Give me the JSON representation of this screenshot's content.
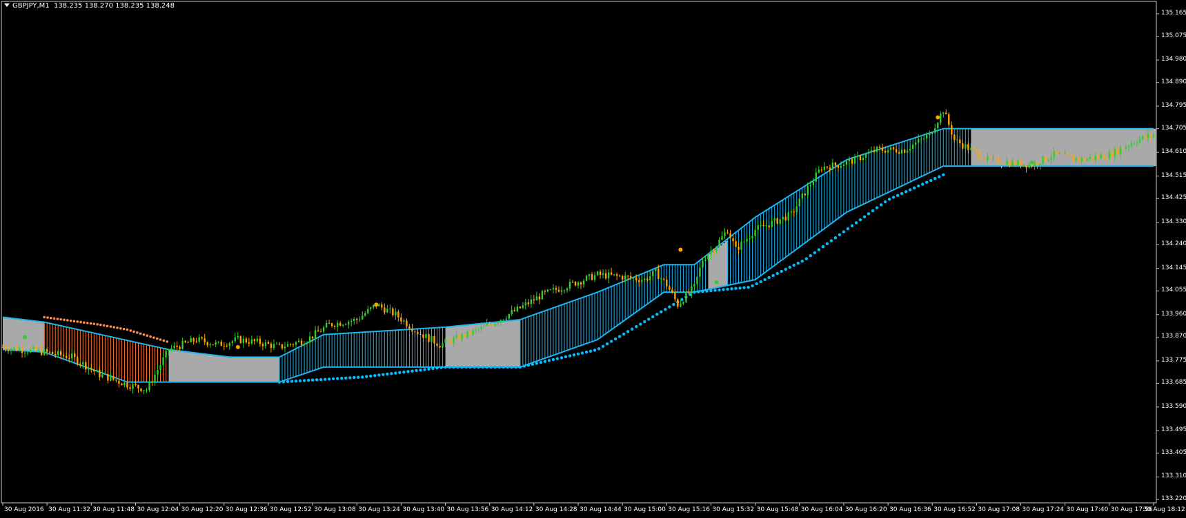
{
  "header": {
    "symbol": "GBPJPY,M1",
    "ohlc": "138.235 138.270 138.235 138.248"
  },
  "y_axis": {
    "labels": [
      "135.165",
      "135.075",
      "134.980",
      "134.890",
      "134.795",
      "134.705",
      "134.610",
      "134.515",
      "134.425",
      "134.330",
      "134.240",
      "134.145",
      "134.055",
      "133.960",
      "133.870",
      "133.775",
      "133.685",
      "133.590",
      "133.495",
      "133.405",
      "133.310",
      "133.220"
    ]
  },
  "x_axis": {
    "labels": [
      "30 Aug 2016",
      "30 Aug 11:32",
      "30 Aug 11:48",
      "30 Aug 12:04",
      "30 Aug 12:20",
      "30 Aug 12:36",
      "30 Aug 12:52",
      "30 Aug 13:08",
      "30 Aug 13:24",
      "30 Aug 13:40",
      "30 Aug 13:56",
      "30 Aug 14:12",
      "30 Aug 14:28",
      "30 Aug 14:44",
      "30 Aug 15:00",
      "30 Aug 15:16",
      "30 Aug 15:32",
      "30 Aug 15:48",
      "30 Aug 16:04",
      "30 Aug 16:20",
      "30 Aug 16:36",
      "30 Aug 16:52",
      "30 Aug 17:08",
      "30 Aug 17:24",
      "30 Aug 17:40",
      "30 Aug 17:56",
      "30 Aug 18:12"
    ]
  },
  "colors": {
    "background": "#000000",
    "frame": "#c8c8c8",
    "bull_candle": "#32cd32",
    "bear_candle": "#ffa500",
    "bull_cloud": "#1eb4f0",
    "bear_cloud": "#ff7832",
    "flat_cloud": "#a9a9a9",
    "trail_line": "#00bfff",
    "orange_line": "#ff8c50"
  },
  "chart_data": {
    "type": "candlestick",
    "symbol": "GBPJPY",
    "timeframe": "M1",
    "ylim": [
      133.22,
      135.165
    ],
    "x_range": [
      "11:16",
      "18:12"
    ],
    "price_path": [
      [
        0,
        133.83
      ],
      [
        15,
        133.81
      ],
      [
        25,
        133.79
      ],
      [
        35,
        133.72
      ],
      [
        45,
        133.68
      ],
      [
        52,
        133.66
      ],
      [
        60,
        133.82
      ],
      [
        70,
        133.86
      ],
      [
        78,
        133.84
      ],
      [
        85,
        133.86
      ],
      [
        92,
        133.85
      ],
      [
        100,
        133.83
      ],
      [
        110,
        133.86
      ],
      [
        118,
        133.92
      ],
      [
        128,
        133.94
      ],
      [
        135,
        134.0
      ],
      [
        142,
        133.96
      ],
      [
        150,
        133.89
      ],
      [
        158,
        133.84
      ],
      [
        168,
        133.88
      ],
      [
        176,
        133.92
      ],
      [
        186,
        133.98
      ],
      [
        195,
        134.04
      ],
      [
        205,
        134.08
      ],
      [
        215,
        134.12
      ],
      [
        225,
        134.11
      ],
      [
        232,
        134.1
      ],
      [
        236,
        134.13
      ],
      [
        240,
        134.08
      ],
      [
        244,
        134.0
      ],
      [
        250,
        134.07
      ],
      [
        253,
        134.18
      ],
      [
        258,
        134.24
      ],
      [
        262,
        134.3
      ],
      [
        265,
        134.22
      ],
      [
        272,
        134.3
      ],
      [
        285,
        134.36
      ],
      [
        290,
        134.45
      ],
      [
        296,
        134.55
      ],
      [
        302,
        134.56
      ],
      [
        308,
        134.58
      ],
      [
        316,
        134.62
      ],
      [
        326,
        134.62
      ],
      [
        335,
        134.68
      ],
      [
        340,
        134.78
      ],
      [
        344,
        134.66
      ],
      [
        350,
        134.62
      ],
      [
        356,
        134.58
      ],
      [
        364,
        134.57
      ],
      [
        372,
        134.56
      ],
      [
        380,
        134.6
      ],
      [
        390,
        134.58
      ],
      [
        400,
        134.6
      ],
      [
        410,
        134.66
      ],
      [
        416,
        134.68
      ]
    ],
    "kumo_top": [
      [
        0,
        133.95
      ],
      [
        15,
        133.93
      ],
      [
        60,
        133.82
      ],
      [
        82,
        133.79
      ],
      [
        85,
        133.79
      ],
      [
        100,
        133.79
      ],
      [
        116,
        133.88
      ],
      [
        160,
        133.91
      ],
      [
        187,
        133.94
      ],
      [
        215,
        134.05
      ],
      [
        239,
        134.16
      ],
      [
        250,
        134.16
      ],
      [
        272,
        134.35
      ],
      [
        305,
        134.58
      ],
      [
        340,
        134.705
      ],
      [
        416,
        134.705
      ]
    ],
    "kumo_bottom": [
      [
        0,
        133.82
      ],
      [
        15,
        133.81
      ],
      [
        45,
        133.69
      ],
      [
        60,
        133.69
      ],
      [
        100,
        133.69
      ],
      [
        116,
        133.75
      ],
      [
        160,
        133.75
      ],
      [
        187,
        133.75
      ],
      [
        215,
        133.86
      ],
      [
        239,
        134.05
      ],
      [
        250,
        134.05
      ],
      [
        272,
        134.1
      ],
      [
        305,
        134.37
      ],
      [
        340,
        134.555
      ],
      [
        416,
        134.555
      ]
    ],
    "trail_stop": [
      [
        100,
        133.69
      ],
      [
        130,
        133.71
      ],
      [
        160,
        133.75
      ],
      [
        187,
        133.75
      ],
      [
        215,
        133.82
      ],
      [
        250,
        134.05
      ],
      [
        270,
        134.07
      ],
      [
        290,
        134.18
      ],
      [
        305,
        134.3
      ],
      [
        320,
        134.42
      ],
      [
        340,
        134.52
      ]
    ],
    "orange_trail": [
      [
        15,
        133.95
      ],
      [
        35,
        133.92
      ],
      [
        45,
        133.9
      ],
      [
        60,
        133.85
      ]
    ]
  }
}
